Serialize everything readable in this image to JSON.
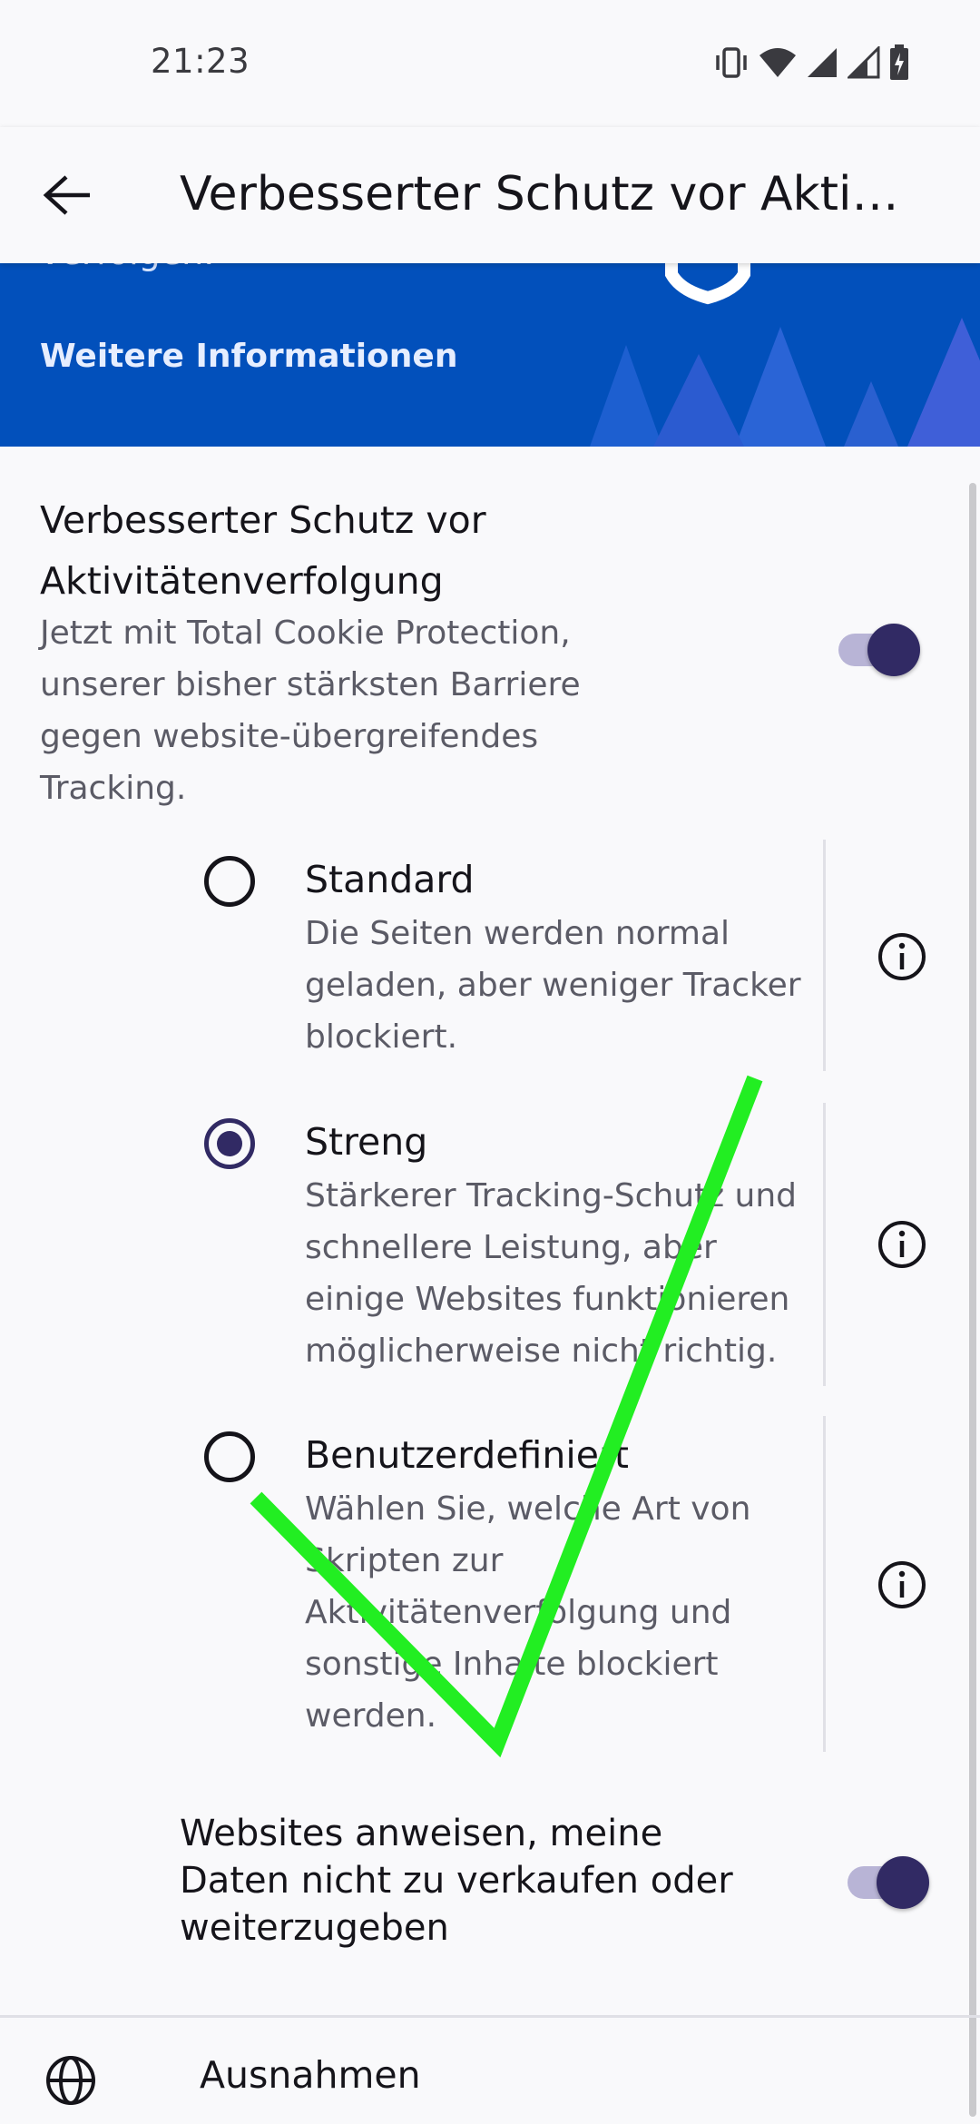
{
  "status_bar": {
    "time": "21:23",
    "icons": [
      "vibrate-icon",
      "wifi-icon",
      "signal-icon",
      "signal-icon",
      "battery-charging-icon"
    ]
  },
  "app_bar": {
    "back_icon": "arrow-back-icon",
    "title": "Verbesserter Schutz vor Aktiv…"
  },
  "banner": {
    "cut_text": "verfolgen.",
    "link": "Weitere Informationen"
  },
  "etp": {
    "title": "Verbesserter Schutz vor Aktivitätenverfolgung",
    "summary": "Jetzt mit Total Cookie Protection, unserer bisher stärksten Barriere gegen website-übergreifendes Tracking.",
    "enabled": true
  },
  "options": [
    {
      "title": "Standard",
      "description": "Die Seiten werden normal geladen, aber weniger Tracker blockiert.",
      "selected": false
    },
    {
      "title": "Streng",
      "description": "Stärkerer Tracking-Schutz und schnellere Leistung, aber einige Websites funktionieren möglicherweise nicht richtig.",
      "selected": true
    },
    {
      "title": "Benutzerdefiniert",
      "description": "Wählen Sie, welche Art von Skripten zur Aktivitätenverfolgung und sonstige Inhalte blockiert werden.",
      "selected": false
    }
  ],
  "gpc": {
    "label": "Websites anweisen, meine Daten nicht zu verkaufen oder weiterzugeben",
    "enabled": true
  },
  "exceptions": {
    "icon": "globe-icon",
    "label": "Ausnahmen"
  },
  "colors": {
    "banner": "#0250bb",
    "accent": "#312a64",
    "annotation": "#22ee22"
  }
}
